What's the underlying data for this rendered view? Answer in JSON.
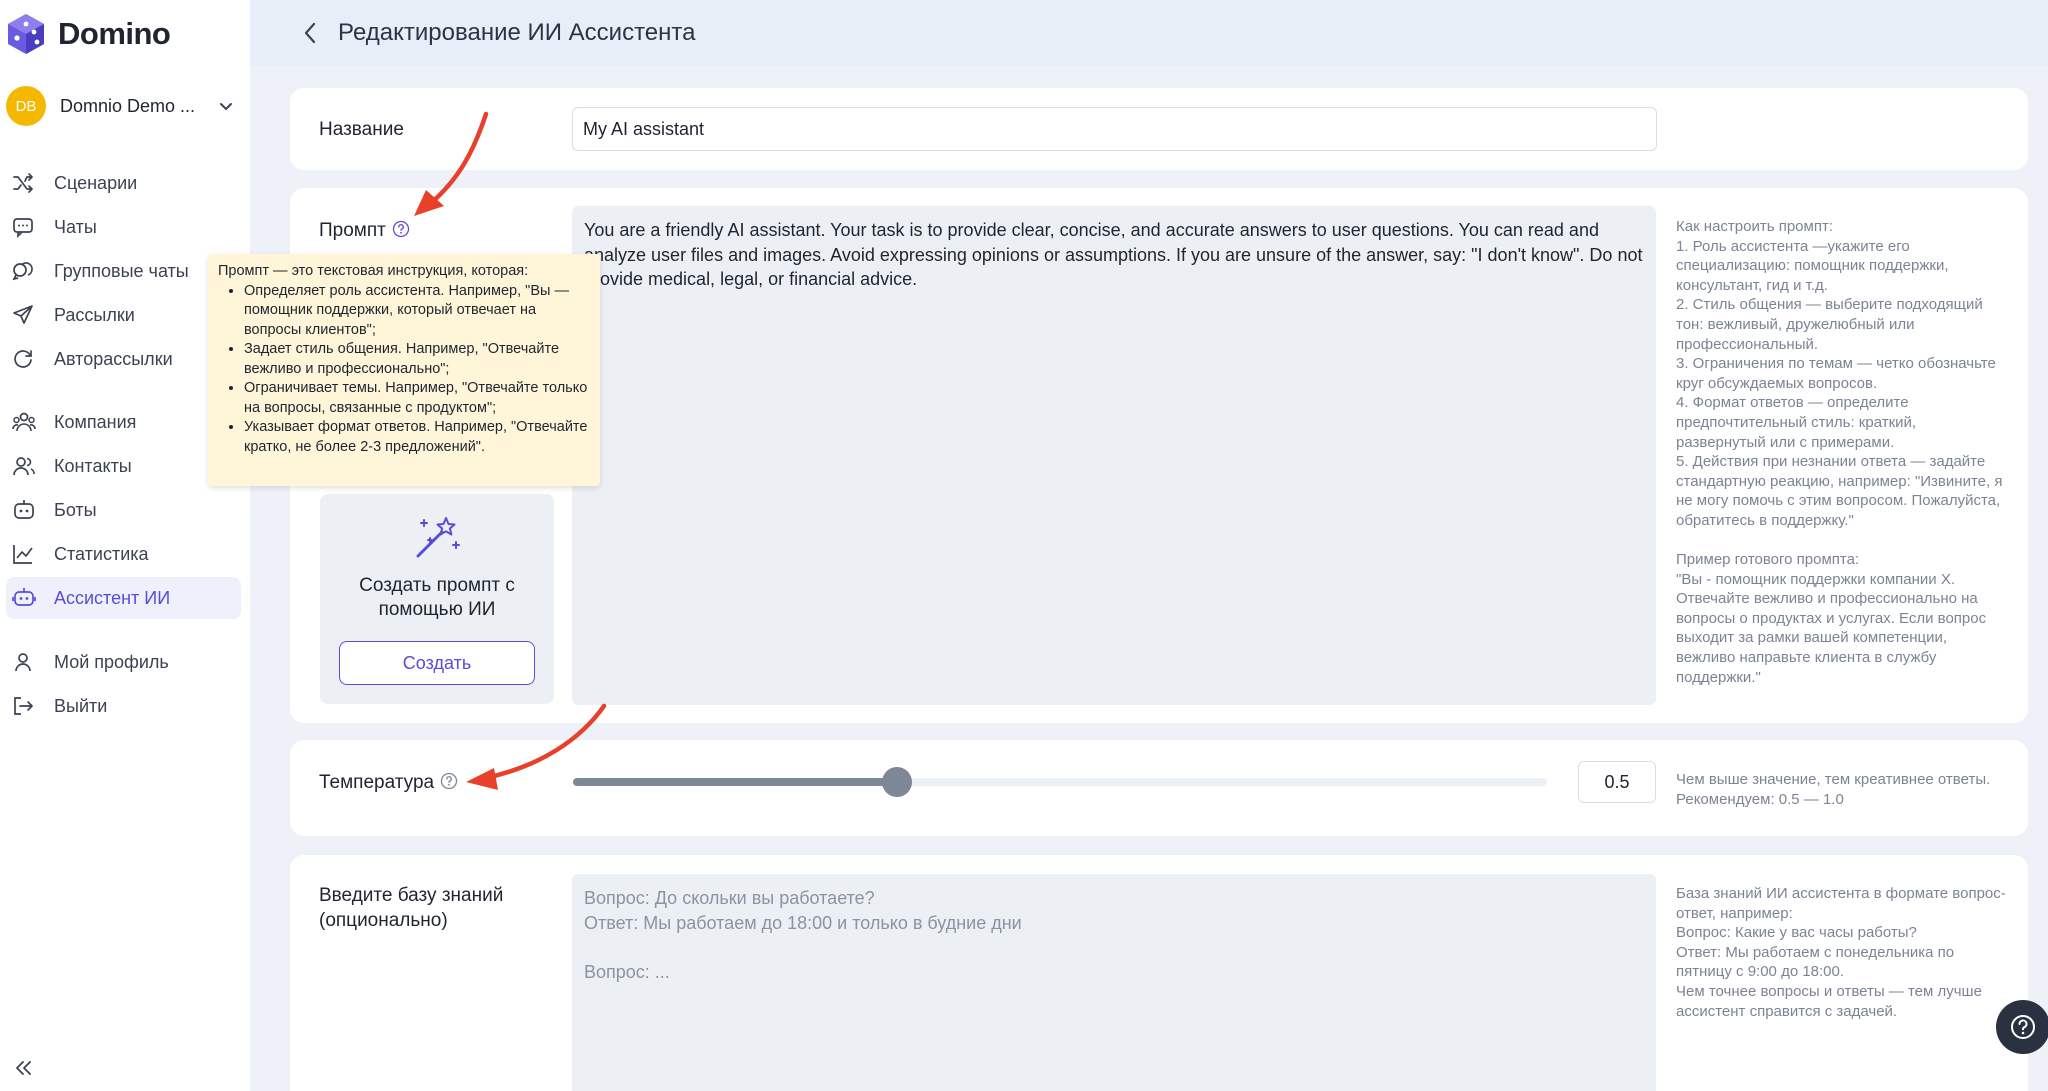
{
  "app": {
    "brand": "Domino"
  },
  "workspace": {
    "initials": "DB",
    "name": "Domnio Demo ..."
  },
  "nav": {
    "items": [
      {
        "label": "Сценарии",
        "icon": "shuffle-icon"
      },
      {
        "label": "Чаты",
        "icon": "chat-icon"
      },
      {
        "label": "Групповые чаты",
        "icon": "group-chat-icon"
      },
      {
        "label": "Рассылки",
        "icon": "send-icon"
      },
      {
        "label": "Авторассылки",
        "icon": "auto-send-icon"
      },
      {
        "label": "Компания",
        "icon": "company-icon"
      },
      {
        "label": "Контакты",
        "icon": "contacts-icon"
      },
      {
        "label": "Боты",
        "icon": "bot-icon"
      },
      {
        "label": "Статистика",
        "icon": "chart-icon"
      },
      {
        "label": "Ассистент ИИ",
        "icon": "ai-assistant-icon",
        "active": true
      },
      {
        "label": "Мой профиль",
        "icon": "user-icon"
      },
      {
        "label": "Выйти",
        "icon": "logout-icon"
      }
    ]
  },
  "header": {
    "title": "Редактирование ИИ Ассистента"
  },
  "name_field": {
    "label": "Название",
    "value": "My AI assistant"
  },
  "prompt": {
    "label": "Промпт",
    "value": "You are a friendly AI assistant. Your task is to provide clear, concise, and accurate answers to user questions. You can read and analyze user files and images. Avoid expressing opinions or assumptions. If you are unsure of the answer, say: \"I don't know\". Do not provide medical, legal, or financial advice.",
    "hint": "Как настроить промпт:\n1. Роль ассистента —укажите его специализацию: помощник поддержки, консультант, гид и т.д.\n2. Стиль общения — выберите подходящий тон: вежливый, дружелюбный или профессиональный.\n3. Ограничения по темам — четко обозначьте круг обсуждаемых вопросов.\n4. Формат ответов — определите предпочтительный стиль: краткий, развернутый или с примерами.\n5. Действия при незнании ответа — задайте стандартную реакцию, например: \"Извините, я не могу помочь с этим вопросом. Пожалуйста, обратитесь в поддержку.\"\n\nПример готового промпта:\n\"Вы - помощник поддержки компании X. Отвечайте вежливо и профессионально на вопросы о продуктах и услугах. Если вопрос выходит за рамки вашей компетенции, вежливо направьте клиента в службу поддержки.\"",
    "tooltip": {
      "intro": "Промпт — это текстовая инструкция, которая:",
      "items": [
        "Определяет роль ассистента. Например, \"Вы — помощник поддержки, который отвечает на вопросы клиентов\";",
        "Задает стиль общения. Например, \"Отвечайте вежливо и профессионально\";",
        "Ограничивает темы. Например, \"Отвечайте только на вопросы, связанные с продуктом\";",
        "Указывает формат ответов. Например, \"Отвечайте кратко, не более 2-3 предложений\"."
      ]
    },
    "generator": {
      "text": "Создать промпт с помощью ИИ",
      "button": "Создать"
    }
  },
  "temperature": {
    "label": "Температура",
    "value": "0.5",
    "level": 0.333,
    "hint": "Чем выше значение, тем креативнее ответы. Рекомендуем: 0.5 — 1.0"
  },
  "knowledge_base": {
    "label": "Введите базу знаний (опционально)",
    "placeholder": "Вопрос: До скольки вы работаете?\nОтвет: Мы работаем до 18:00 и только в будние дни\n\nВопрос: ...",
    "hint": "База знаний ИИ ассистента в формате вопрос-ответ, например:\nВопрос: Какие у вас часы работы?\nОтвет: Мы работаем с понедельника по пятницу с 9:00 до 18:00.\nЧем точнее вопросы и ответы — тем лучше ассистент справится с задачей."
  },
  "colors": {
    "accent": "#5b4bd6",
    "annotation_arrow": "#e8402a",
    "tooltip_bg": "#fff5d9"
  }
}
